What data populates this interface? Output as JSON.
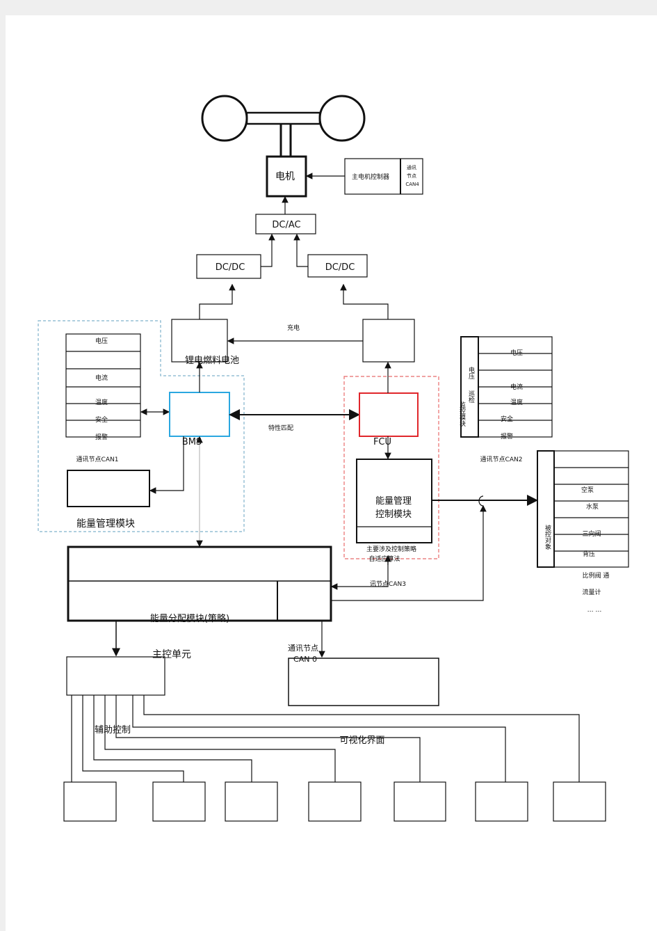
{
  "motor": {
    "label": "电机",
    "controller": "主电机控制器",
    "node_l1": "通讯",
    "node_l2": "节点",
    "node_l3": "CAN4"
  },
  "dcac": "DC/AC",
  "dcdc_left": "DC/DC",
  "dcdc_right": "DC/DC",
  "battery": "锂电燃料电池",
  "charge": "充电",
  "left_table": [
    "电压",
    "电流",
    "温度",
    "安全",
    "报警"
  ],
  "bms": "BMS",
  "match": "特性匹配",
  "fcu": "FCU",
  "can1": "通讯节点CAN1",
  "energy_module": "能量管理模块",
  "emc": {
    "line1": "能量管理",
    "line2": "控制模块",
    "note1": "主要涉及控制策略",
    "note2": "自适应算法"
  },
  "monitor": {
    "inner_l1": "电压",
    "inner_l2": "巡检",
    "outer": "监控模块",
    "rows": [
      "电压",
      "电流",
      "温度",
      "安全",
      "报警"
    ]
  },
  "can2": "通讯节点CAN2",
  "controlled": {
    "side": "被控对象",
    "rows": [
      "空泵",
      "水泵",
      "三向阀",
      "背压"
    ],
    "extra": [
      "比例阀 通",
      "流量计",
      "… …"
    ]
  },
  "can3": "讯节点CAN3",
  "distribution": "能量分配模块(策略)",
  "main_unit": "主控单元",
  "can0_l1": "通讯节点",
  "can0_l2": "CAN 0",
  "aux": "辅助控制",
  "visual": "可视化界面",
  "colors": {
    "bms": "#2aa7e0",
    "fcu": "#e0262b",
    "blue_dash": "#7fb2cc",
    "red_dash": "#e86a6a"
  }
}
